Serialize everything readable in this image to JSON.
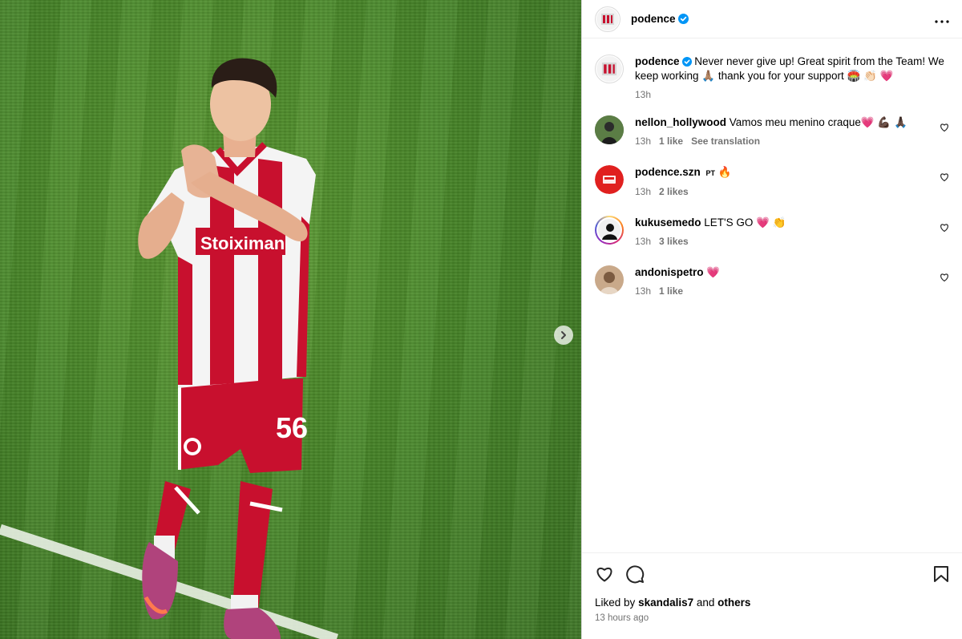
{
  "post": {
    "author": "podence",
    "verified": true
  },
  "caption": {
    "username": "podence",
    "text": "Never never give up! Great spirit from the Team! We keep working 🙏🏽 thank you for your support 🏟️ 👏🏻 💗",
    "time": "13h"
  },
  "comments": [
    {
      "username": "nellon_hollywood",
      "text": "Vamos meu menino craque💗 💪🏿 🙏🏿",
      "time": "13h",
      "likes": "1 like",
      "extra": "See translation"
    },
    {
      "username": "podence.szn",
      "lang": "PT",
      "text": "🔥",
      "time": "13h",
      "likes": "2 likes"
    },
    {
      "username": "kukusemedo",
      "text": "LET'S GO 💗 👏",
      "time": "13h",
      "likes": "3 likes"
    },
    {
      "username": "andonispetro",
      "text": "💗",
      "time": "13h",
      "likes": "1 like"
    }
  ],
  "footer": {
    "liked_prefix": "Liked by",
    "liked_user": "skandalis7",
    "liked_and": "and",
    "liked_others": "others",
    "timestamp": "13 hours ago"
  },
  "media": {
    "jersey_sponsor": "Stoiximan",
    "jersey_number": "56"
  },
  "icons": {
    "header_more": "more-options-icon",
    "next": "chevron-right-icon",
    "like": "heart-icon",
    "comment": "comment-icon",
    "save": "bookmark-icon",
    "verified": "verified-badge-icon"
  },
  "colors": {
    "verified": "#0095f6",
    "muted": "#737373",
    "border": "#dbdbdb",
    "club_red": "#c8102e"
  }
}
